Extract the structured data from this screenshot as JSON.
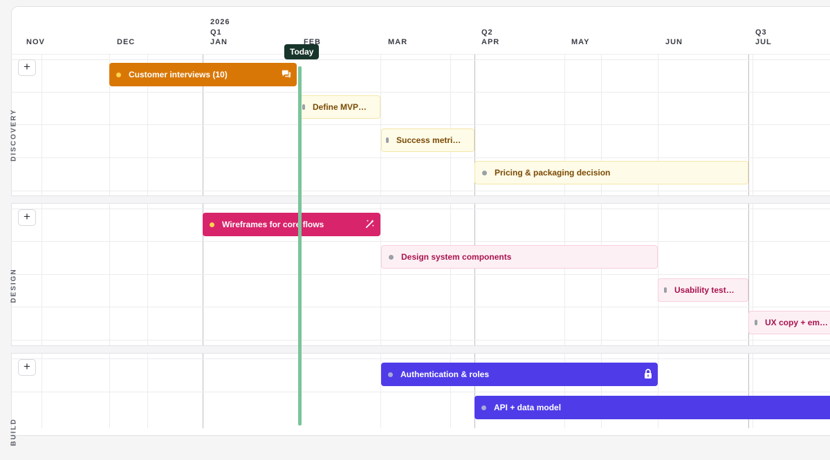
{
  "timeline": {
    "year": "2026",
    "quarters": [
      "Q1",
      "Q2",
      "Q3"
    ],
    "months": [
      "NOV",
      "DEC",
      "JAN",
      "FEB",
      "MAR",
      "APR",
      "MAY",
      "JUN",
      "JUL"
    ],
    "today_label": "Today"
  },
  "lanes": [
    {
      "label": "DISCOVERY",
      "add_label": "+"
    },
    {
      "label": "DESIGN",
      "add_label": "+"
    },
    {
      "label": "BUILD",
      "add_label": "+"
    }
  ],
  "items": {
    "customer_interviews": "Customer interviews (10)",
    "define_mvp": "Define MVP…",
    "success_metrics": "Success metri…",
    "pricing": "Pricing & packaging decision",
    "wireframes": "Wireframes for core flows",
    "design_system": "Design system components",
    "usability": "Usability test…",
    "ux_copy": "UX copy + em…",
    "auth": "Authentication & roles",
    "api": "API + data model"
  },
  "colors": {
    "discovery_solid": "#d97706",
    "discovery_light": "#fefbe8",
    "design_solid": "#d8246b",
    "design_light": "#fdf0f4",
    "build_solid": "#4f3ce8",
    "today": "#79c59a"
  },
  "icons": {
    "customer_interviews": "chat-bubbles-icon",
    "wireframes": "magic-wand-icon",
    "auth": "lock-icon"
  }
}
